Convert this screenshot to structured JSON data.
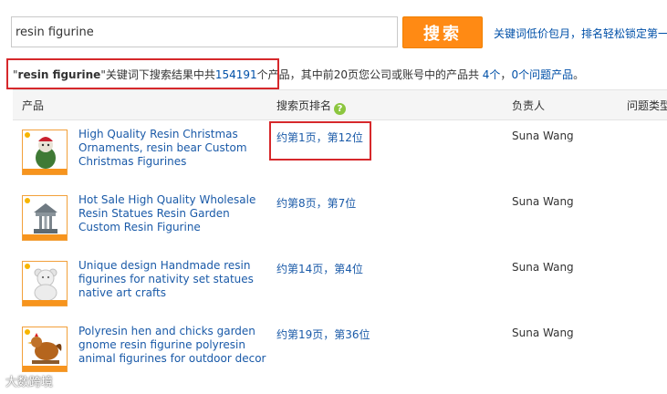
{
  "search": {
    "value": "resin figurine",
    "button_label": "搜索",
    "promo_text": "关键词低价包月，排名轻松锁定第一"
  },
  "summary": {
    "open_quote": "\"",
    "keyword": "resin figurine",
    "close_quote": "\"",
    "text1": "关键词下搜索结果中共",
    "total": "154191",
    "text2": "个产品，",
    "text3": "其中前20页您公司或账号中的产品共 ",
    "own_count": "4个",
    "sep": "，",
    "issue_count": "0个问题产品",
    "end": "。"
  },
  "table": {
    "headers": {
      "product": "产品",
      "rank": "搜索页排名",
      "owner": "负责人",
      "issue_type": "问题类型"
    },
    "rows": [
      {
        "title": "High Quality Resin Christmas Ornaments, resin bear Custom Christmas Figurines",
        "rank": "约第1页，第12位",
        "owner": "Suna Wang",
        "thumb": "christmas-bear"
      },
      {
        "title": "Hot Sale High Quality Wholesale Resin Statues Resin Garden Custom Resin Figurine",
        "rank": "约第8页，第7位",
        "owner": "Suna Wang",
        "thumb": "carousel"
      },
      {
        "title": "Unique design Handmade resin figurines for nativity set statues native art crafts",
        "rank": "约第14页，第4位",
        "owner": "Suna Wang",
        "thumb": "white-bear"
      },
      {
        "title": "Polyresin hen and chicks garden gnome resin figurine polyresin animal figurines for outdoor decor",
        "rank": "约第19页，第36位",
        "owner": "Suna Wang",
        "thumb": "hen"
      }
    ]
  },
  "watermark": "大数跨境",
  "colors": {
    "accent": "#ff8a14",
    "link": "#1a5aa8",
    "highlight": "#d6282b"
  }
}
